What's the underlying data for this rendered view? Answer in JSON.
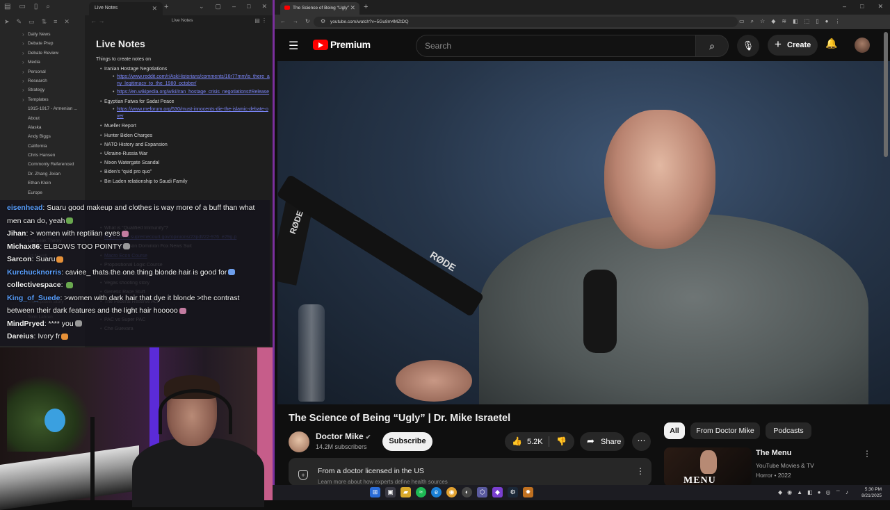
{
  "notes_app": {
    "tab_title": "Live Notes",
    "doc_header_title": "Live Notes",
    "folders": [
      "Daily News",
      "Debate Prep",
      "Debate Review",
      "Media",
      "Personal",
      "Research",
      "Strategy",
      "Templates",
      "1915-1917 - Armenian ...",
      "About",
      "Alaska",
      "Andy Biggs",
      "California",
      "Chris Hansen",
      "Commonly Referenced",
      "Dr. Zhang Jixian",
      "Ethan Klein",
      "Europe"
    ],
    "folders_lower": [
      "Lab Leak Theory",
      "Liz Morrill",
      "Marco Rubio",
      "Rotoko",
      "The Epstein Story",
      "Tomi Lahren"
    ],
    "page_title": "Live Notes",
    "intro": "Things to create notes on",
    "outline": [
      {
        "level": 1,
        "text": "Iranian Hostage Negotiations"
      },
      {
        "level": 2,
        "text": "https://www.reddit.com/r/AskHistorians/comments/16r77mm/is_there_any_legitimacy_to_the_1980_october/",
        "link": true
      },
      {
        "level": 2,
        "text": "https://en.wikipedia.org/wiki/Iran_hostage_crisis_negotiations#Release",
        "link": true
      },
      {
        "level": 1,
        "text": "Egyptian Fatwa for Sadat Peace"
      },
      {
        "level": 2,
        "text": "https://www.meforum.org/530/must-innocents-die-the-islamic-debate-over",
        "link": true
      },
      {
        "level": 1,
        "text": "Mueller Report"
      },
      {
        "level": 1,
        "text": "Hunter Biden Charges"
      },
      {
        "level": 1,
        "text": "NATO History and Expansion"
      },
      {
        "level": 1,
        "text": "Ukraine-Russia War"
      },
      {
        "level": 1,
        "text": "Nixon Watergate Scandal"
      },
      {
        "level": 1,
        "text": "Biden's “quid pro quo”"
      },
      {
        "level": 1,
        "text": "Bin Laden relationship to Saudi Family"
      }
    ],
    "outline_lower": [
      {
        "text": "What is “Qualified Immunity”?"
      },
      {
        "text": "https://www.supremecourt.gov/opinions/23pdf/22-976_e29g.p",
        "link": true
      },
      {
        "text": "Tucker Carlson Dominion Fox News Suit"
      },
      {
        "text": "Macro Econ Course",
        "link": true
      },
      {
        "text": "Propositional Logic Course"
      },
      {
        "text": "Who Classifies things in the United States"
      },
      {
        "text": "Vegas shooting story"
      },
      {
        "text": "Genetic Race Stuff"
      },
      {
        "text": "The Federal Reserve Act"
      },
      {
        "text": "Bush v Gore"
      },
      {
        "text": "PAC vs Super PAC"
      },
      {
        "text": "Che Guevara"
      }
    ]
  },
  "chat": [
    {
      "name": "eisenhead",
      "color": "#5aa0ff",
      "msg": "Suaru good makeup and clothes is way more of a buff than what men can do, yeah"
    },
    {
      "name": "Jihan",
      "color": "#f2f2f2",
      "msg": "> women with reptilian eyes"
    },
    {
      "name": "Michax86",
      "color": "#f2f2f2",
      "msg": "ELBOWS TOO POINTY"
    },
    {
      "name": "Sarcon",
      "color": "#f2f2f2",
      "msg": "Suaru"
    },
    {
      "name": "Kurchucknorris",
      "color": "#5aa0ff",
      "msg": "caviee_ thats the one thing blonde hair is good for"
    },
    {
      "name": "collectivespace",
      "color": "#f2f2f2",
      "msg": ""
    },
    {
      "name": "King_of_Suede",
      "color": "#5aa0ff",
      "msg": ">women with dark hair that dye it blonde >the contrast between their dark features and the light hair hooooo"
    },
    {
      "name": "MindPryed",
      "color": "#f2f2f2",
      "msg": "**** you"
    },
    {
      "name": "Dareius",
      "color": "#f2f2f2",
      "msg": "Ivory fr"
    }
  ],
  "browser": {
    "tab_title": "The Science of Being “Ugly”",
    "url": "youtube.com/watch?v=5Gu8m4MZtDQ",
    "brand": "Premium",
    "search_placeholder": "Search",
    "create_label": "Create"
  },
  "video": {
    "title": "The Science of Being “Ugly” | Dr. Mike Israetel",
    "channel": "Doctor Mike",
    "verified_mark": "✔",
    "subscribers": "14.2M subscribers",
    "subscribe_label": "Subscribe",
    "likes": "5.2K",
    "share_label": "Share",
    "doctor_notice": "From a doctor licensed in the US",
    "doctor_sub": "Learn more about how experts define health sources",
    "video_text_1": "RØDE",
    "video_text_2": "RØDE"
  },
  "chips": [
    "All",
    "From Doctor Mike",
    "Podcasts"
  ],
  "recommended": {
    "title": "The Menu",
    "channel": "YouTube Movies & TV",
    "meta": "Horror • 2022",
    "thumb_text": "MENU"
  },
  "taskbar": {
    "time": "5:30 PM",
    "date": "8/21/2025"
  },
  "colors": {
    "yt_red": "#ff0000",
    "accent_link": "#7b86f8",
    "border_purple": "#7a2f9c"
  }
}
